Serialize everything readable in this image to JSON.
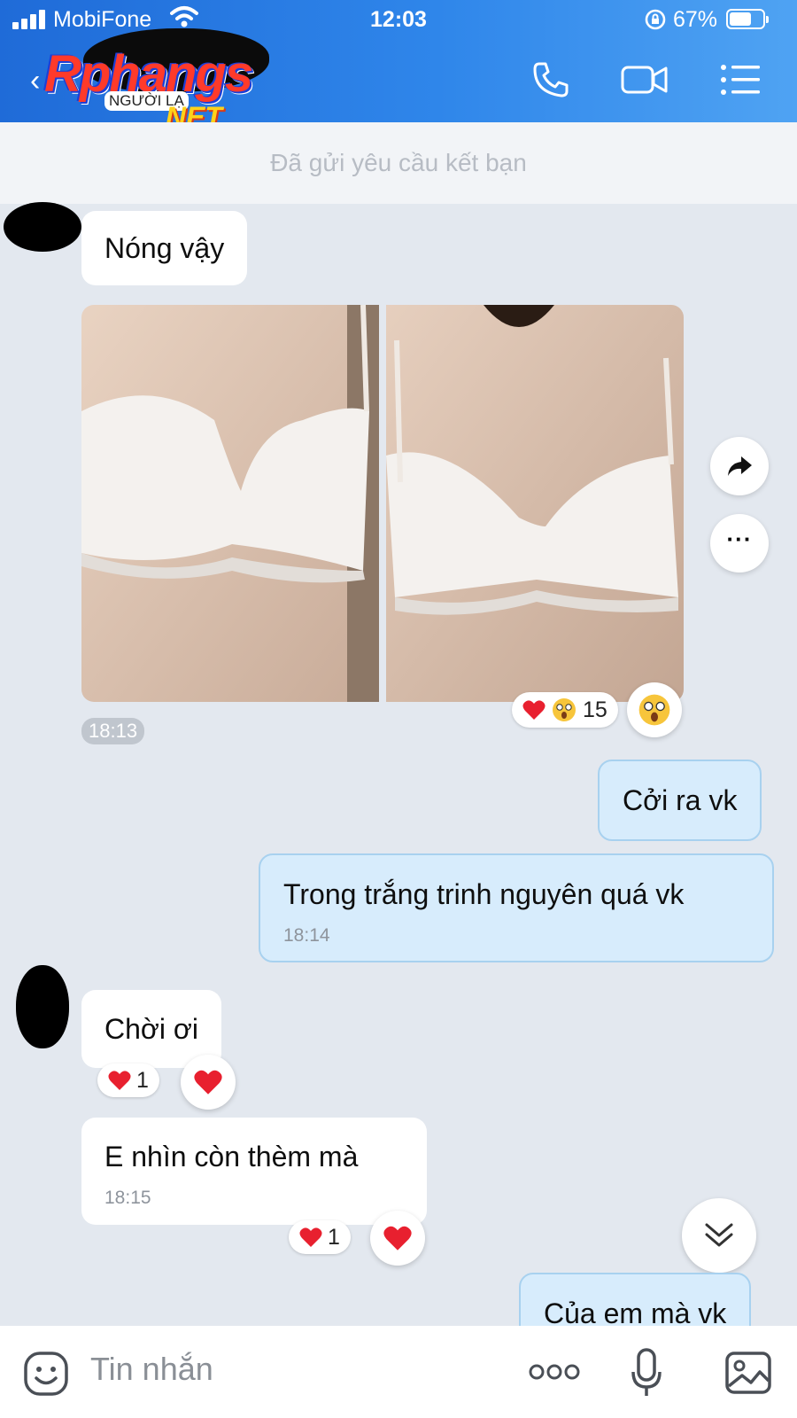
{
  "status_bar": {
    "carrier": "MobiFone",
    "time": "12:03",
    "battery": "67%",
    "battery_level": 0.67
  },
  "header": {
    "logo": {
      "brand": "Rphangs",
      "tag": "NGƯỜI LẠ",
      "suffix": ".NET"
    },
    "icons": [
      "back-icon",
      "phone-icon",
      "video-icon",
      "menu-icon"
    ]
  },
  "friend_request_notice": "Đã gửi yêu cầu kết bạn",
  "messages": {
    "m1": {
      "text": "Nóng vậy"
    },
    "photo_group": {
      "time": "18:13",
      "reaction_count": "15"
    },
    "m2": {
      "text": "Cởi ra vk"
    },
    "m3": {
      "text": "Trong trắng trinh nguyên quá vk",
      "time": "18:14"
    },
    "m4": {
      "text": "Chời ơi",
      "reaction_count": "1"
    },
    "m5": {
      "text": "E nhìn còn thèm mà",
      "time": "18:15",
      "reaction_count": "1"
    },
    "m6": {
      "text": "Của em mà vk"
    }
  },
  "input": {
    "placeholder": "Tin nhắn"
  },
  "colors": {
    "header_start": "#1f6bd8",
    "header_end": "#4fa3f3",
    "outgoing_bubble": "#d7ecfc",
    "chat_bg": "#e3e8ef"
  }
}
